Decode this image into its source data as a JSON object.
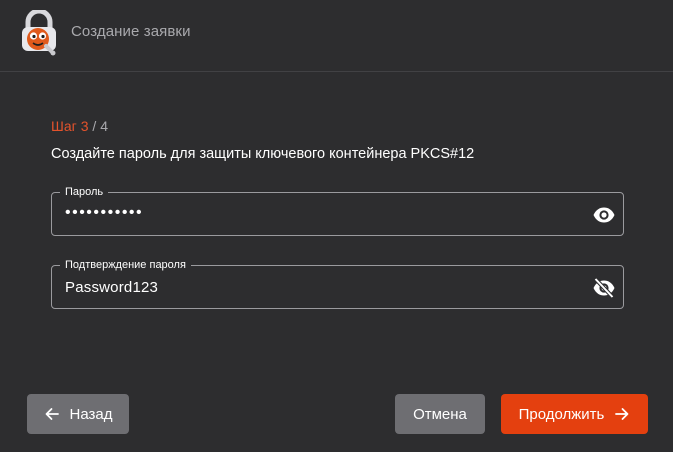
{
  "header": {
    "title": "Создание заявки",
    "logo_icon": "lock-mascot-logo"
  },
  "wizard": {
    "step_label": "Шаг",
    "step_current": "3",
    "step_separator": "/",
    "step_total": "4",
    "subtitle": "Создайте пароль для защиты ключевого контейнера PKCS#12"
  },
  "fields": {
    "password": {
      "label": "Пароль",
      "value": "•••••••••••",
      "visibility_icon": "eye-icon"
    },
    "confirm": {
      "label": "Подтверждение пароля",
      "value": "Password123",
      "visibility_icon": "eye-off-icon"
    }
  },
  "buttons": {
    "back": "Назад",
    "cancel": "Отмена",
    "continue": "Продолжить"
  },
  "colors": {
    "background": "#2d2d2f",
    "accent": "#e4400f",
    "step_accent": "#e4532c",
    "muted_text": "#a9a9ad",
    "secondary_button": "#6e6e72"
  }
}
